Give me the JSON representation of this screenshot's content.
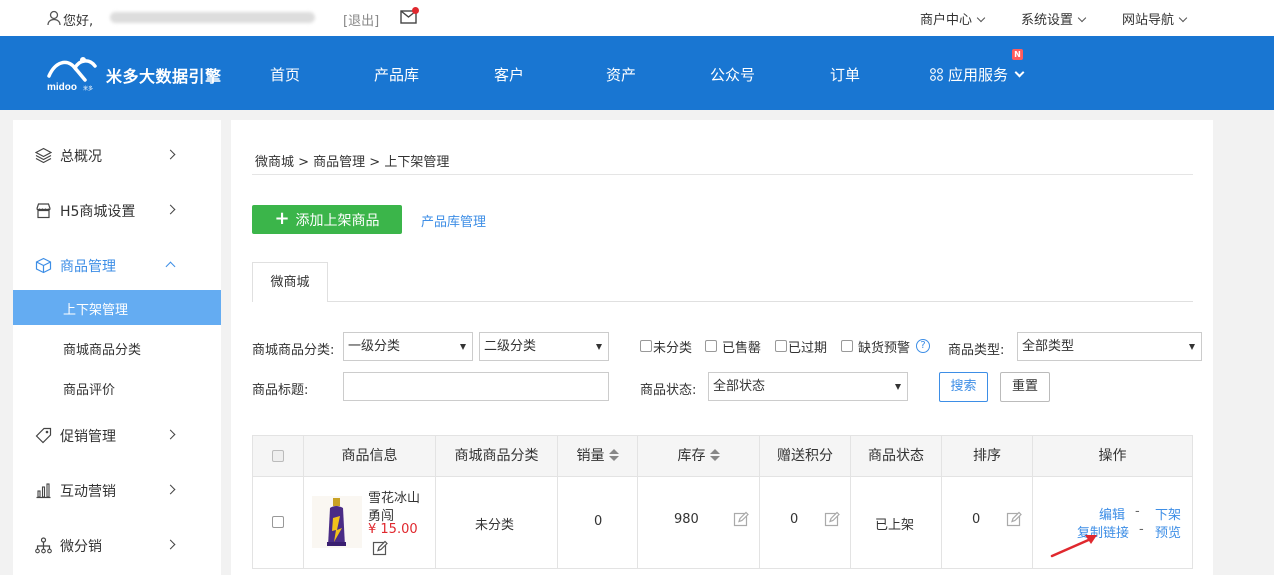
{
  "topbar": {
    "greeting": "您好,",
    "logout": "[退出]",
    "menus": [
      "商户中心",
      "系统设置",
      "网站导航"
    ]
  },
  "brand": {
    "logo_text": "midoo",
    "logo_sub": "米多",
    "name": "米多大数据引擎"
  },
  "nav": {
    "items": [
      "首页",
      "产品库",
      "客户",
      "资产",
      "公众号",
      "订单"
    ],
    "apps": "应用服务",
    "badge": "N"
  },
  "sidebar": {
    "items": [
      {
        "label": "总概况",
        "icon": "layers-icon"
      },
      {
        "label": "H5商城设置",
        "icon": "shop-icon"
      },
      {
        "label": "商品管理",
        "icon": "box-icon"
      },
      {
        "label": "促销管理",
        "icon": "tag-icon"
      },
      {
        "label": "互动营销",
        "icon": "bar-chart-icon"
      },
      {
        "label": "微分销",
        "icon": "org-tree-icon"
      }
    ],
    "sub_items": [
      "上下架管理",
      "商城商品分类",
      "商品评价"
    ]
  },
  "breadcrumb": "微商城 > 商品管理 > 上下架管理",
  "actions": {
    "add_button": "添加上架商品",
    "library_link": "产品库管理"
  },
  "tab": "微商城",
  "filters": {
    "category_label": "商城商品分类:",
    "level1": "一级分类",
    "level2": "二级分类",
    "checks": [
      "未分类",
      "已售罄",
      "已过期",
      "缺货预警"
    ],
    "help": "?",
    "type_label": "商品类型:",
    "type_value": "全部类型",
    "title_label": "商品标题:",
    "status_label": "商品状态:",
    "status_value": "全部状态",
    "search": "搜索",
    "reset": "重置"
  },
  "table": {
    "headers": [
      "商品信息",
      "商城商品分类",
      "销量",
      "库存",
      "赠送积分",
      "商品状态",
      "排序",
      "操作"
    ],
    "rows": [
      {
        "name_line1": "雪花冰山",
        "name_line2": "勇闯",
        "price": "¥ 15.00",
        "category": "未分类",
        "sales": "0",
        "stock": "980",
        "points": "0",
        "status": "已上架",
        "sort": "0",
        "ops": {
          "edit": "编辑",
          "offshelf": "下架",
          "copy": "复制链接",
          "preview": "预览",
          "sep": "-"
        }
      }
    ]
  },
  "colors": {
    "nav_blue": "#1976d2",
    "accent": "#3d8ee6",
    "add_green": "#3bb54a",
    "price_red": "#e0282e"
  }
}
